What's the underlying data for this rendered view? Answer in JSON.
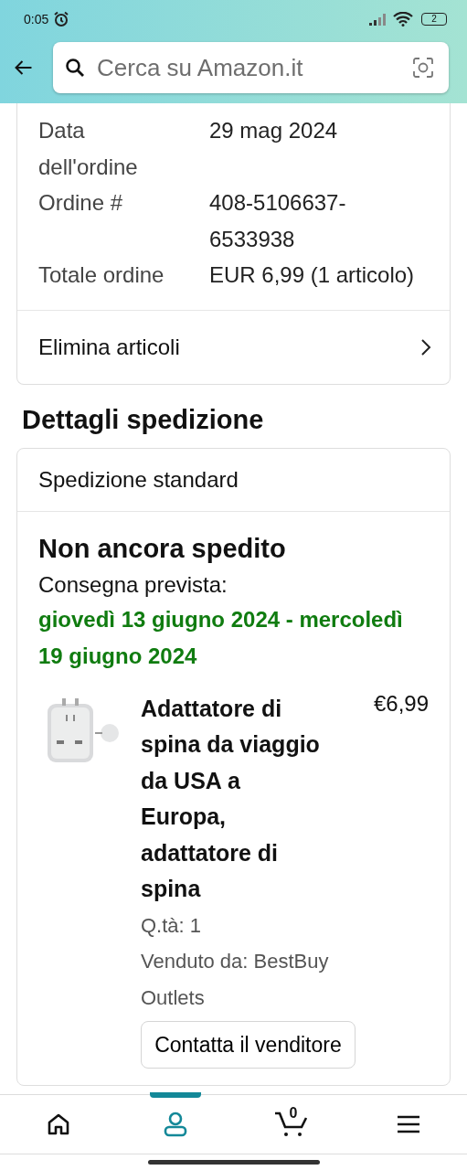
{
  "status_bar": {
    "time": "0:05",
    "battery": "2"
  },
  "search": {
    "placeholder": "Cerca su Amazon.it"
  },
  "order_info": {
    "rows": [
      {
        "label": "Data dell'ordine",
        "value": "29 mag 2024"
      },
      {
        "label": "Ordine #",
        "value": "408-5106637-6533938"
      },
      {
        "label": "Totale ordine",
        "value": "EUR 6,99 (1 articolo)"
      }
    ],
    "action": "Elimina articoli"
  },
  "shipment": {
    "heading": "Dettagli spedizione",
    "method": "Spedizione standard",
    "status": "Non ancora spedito",
    "delivery_label": "Consegna prevista:",
    "delivery_dates": "giovedì 13 giugno 2024 - mercoledì 19 giugno 2024",
    "item": {
      "kind": "picture",
      "title": "Adattatore di spina da viaggio da USA a Europa, adattatore di spina",
      "price": "€6,99",
      "quantity": "Q.tà: 1",
      "seller": "Venduto da: BestBuy Outlets"
    },
    "contact_button": "Contatta il venditore"
  },
  "nav": [
    {
      "kind": "home",
      "selected": false
    },
    {
      "kind": "account",
      "selected": true
    },
    {
      "kind": "cart",
      "selected": false,
      "count": "0"
    },
    {
      "kind": "menu",
      "selected": false
    }
  ]
}
